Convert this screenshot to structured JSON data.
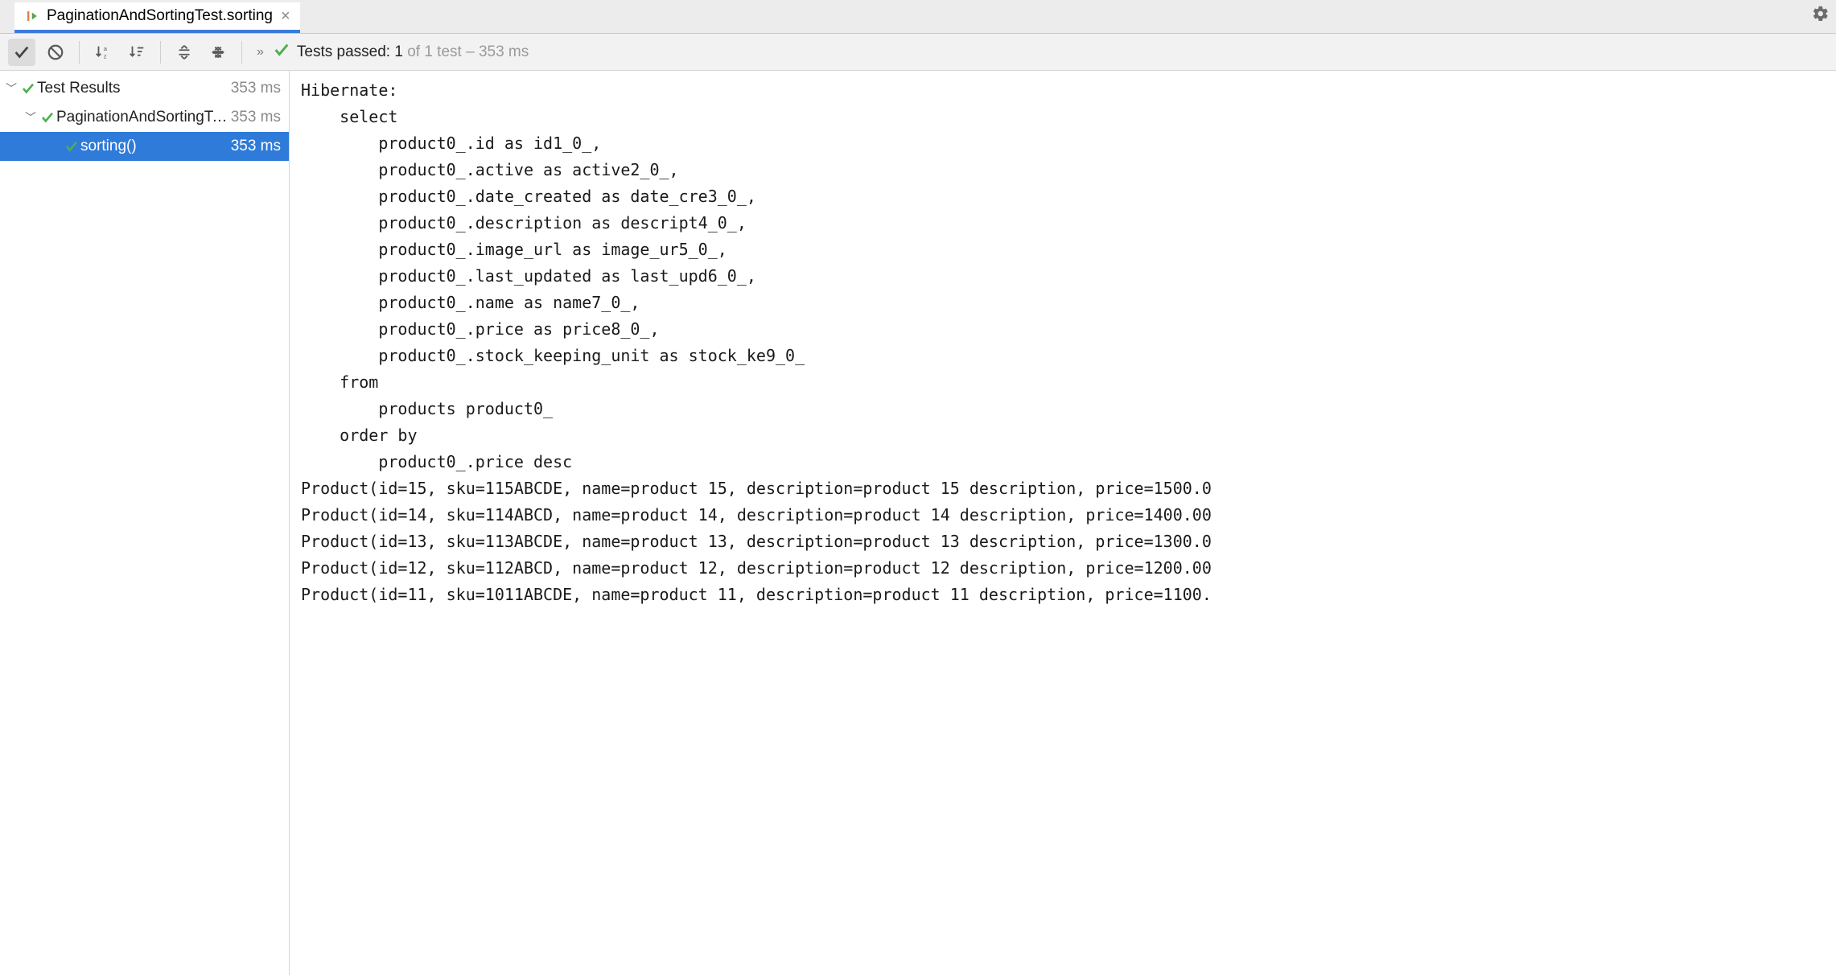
{
  "tab": {
    "label": "PaginationAndSortingTest.sorting"
  },
  "status": {
    "prefix": "Tests passed: ",
    "passed": "1",
    "of": " of 1 test – ",
    "time": "353 ms"
  },
  "tree": {
    "rows": [
      {
        "label": "Test Results",
        "ms": "353 ms"
      },
      {
        "label": "PaginationAndSortingTest",
        "ms": "353 ms"
      },
      {
        "label": "sorting()",
        "ms": "353 ms"
      }
    ]
  },
  "console_lines": [
    "Hibernate: ",
    "    select",
    "        product0_.id as id1_0_,",
    "        product0_.active as active2_0_,",
    "        product0_.date_created as date_cre3_0_,",
    "        product0_.description as descript4_0_,",
    "        product0_.image_url as image_ur5_0_,",
    "        product0_.last_updated as last_upd6_0_,",
    "        product0_.name as name7_0_,",
    "        product0_.price as price8_0_,",
    "        product0_.stock_keeping_unit as stock_ke9_0_ ",
    "    from",
    "        products product0_ ",
    "    order by",
    "        product0_.price desc",
    "Product(id=15, sku=115ABCDE, name=product 15, description=product 15 description, price=1500.0",
    "Product(id=14, sku=114ABCD, name=product 14, description=product 14 description, price=1400.00",
    "Product(id=13, sku=113ABCDE, name=product 13, description=product 13 description, price=1300.0",
    "Product(id=12, sku=112ABCD, name=product 12, description=product 12 description, price=1200.00",
    "Product(id=11, sku=1011ABCDE, name=product 11, description=product 11 description, price=1100."
  ]
}
